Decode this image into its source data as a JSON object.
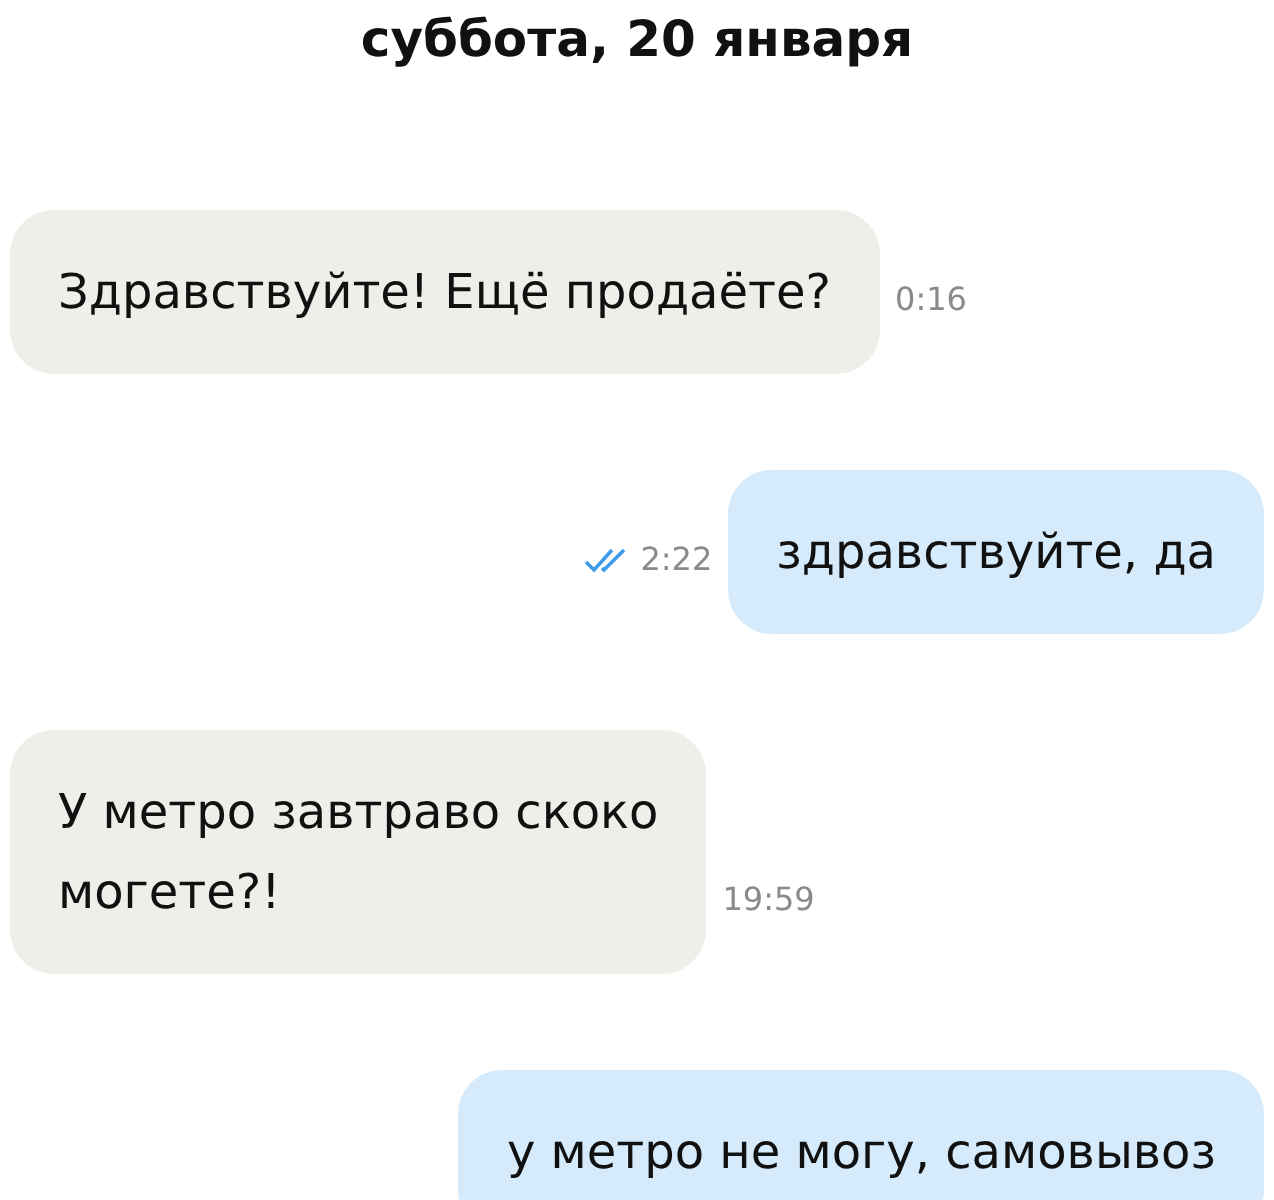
{
  "date": "суббота, 20 января",
  "messages": [
    {
      "kind": "incoming",
      "lines": [
        "Здравствуйте! Ещё продаёте?"
      ],
      "time": "0:16"
    },
    {
      "kind": "outgoing",
      "lines": [
        "здравствуйте, да"
      ],
      "time": "2:22",
      "read": true
    },
    {
      "kind": "incoming",
      "lines": [
        "У метро завтраво скоко",
        "могете?!"
      ],
      "time": "19:59"
    },
    {
      "kind": "outgoing",
      "lines": [
        "у метро не могу, самовывоз"
      ]
    }
  ]
}
